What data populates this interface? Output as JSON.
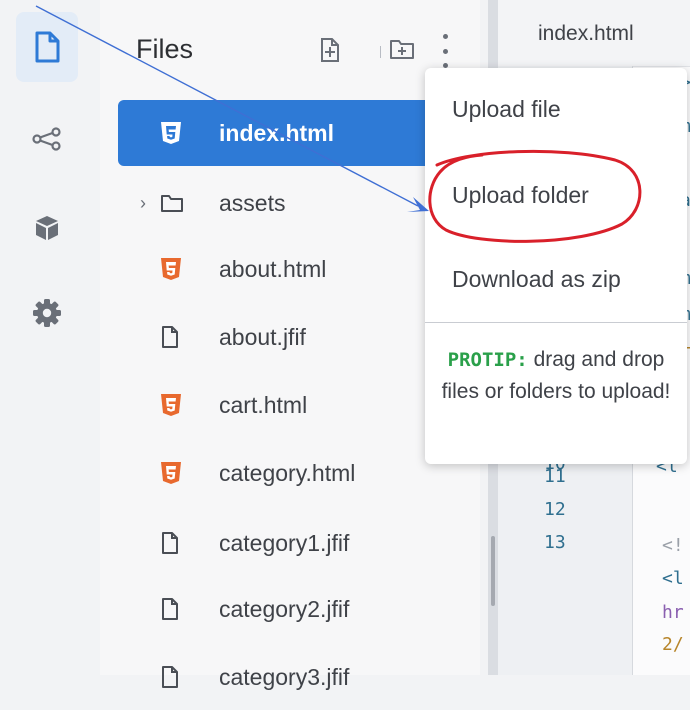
{
  "sidebar_icons": [
    "file-icon",
    "share-icon",
    "package-icon",
    "gear-icon"
  ],
  "files_panel": {
    "title": "Files",
    "items": [
      {
        "label": "index.html",
        "icon": "html5-icon",
        "selected": true
      },
      {
        "label": "assets",
        "icon": "folder-icon",
        "folder": true
      },
      {
        "label": "about.html",
        "icon": "html5-icon"
      },
      {
        "label": "about.jfif",
        "icon": "file-icon"
      },
      {
        "label": "cart.html",
        "icon": "html5-icon"
      },
      {
        "label": "category.html",
        "icon": "html5-icon"
      },
      {
        "label": "category1.jfif",
        "icon": "file-icon"
      },
      {
        "label": "category2.jfif",
        "icon": "file-icon"
      },
      {
        "label": "category3.jfif",
        "icon": "file-icon"
      }
    ]
  },
  "editor": {
    "tab": "index.html",
    "line_numbers": [
      "10",
      "11",
      "12",
      "13"
    ],
    "code_fragments": [
      {
        "text": "<l",
        "color": "#2f6f8f"
      },
      {
        "text": "<!",
        "color": "#9aa0a8"
      },
      {
        "text": "<l",
        "color": "#2f6f8f"
      },
      {
        "text": "hr",
        "color": "#8a5fb0"
      },
      {
        "text": "2/",
        "color": "#b7852a"
      }
    ],
    "peek_fragments": [
      {
        "text": ">",
        "color": "#2f6f8f"
      },
      {
        "text": "m",
        "color": "#2f6f8f"
      },
      {
        "text": "a",
        "color": "#2f6f8f"
      },
      {
        "text": "!",
        "color": "#9aa0a8"
      },
      {
        "text": "m",
        "color": "#2f6f8f"
      },
      {
        "text": "m",
        "color": "#2f6f8f"
      },
      {
        "text": "T",
        "color": "#b7852a"
      },
      {
        "text": "!",
        "color": "#9aa0a8"
      }
    ]
  },
  "menu": {
    "items": [
      "Upload file",
      "Upload folder",
      "Download as zip"
    ],
    "protip_label": "PROTIP:",
    "protip_text": " drag and drop files or folders to upload!"
  },
  "colors": {
    "selected_row": "#2e7ad6",
    "html_icon": "#e8692e",
    "annotation_circle": "#d9202a",
    "annotation_arrow": "#3f6fd4",
    "protip_green": "#2aa04a"
  }
}
